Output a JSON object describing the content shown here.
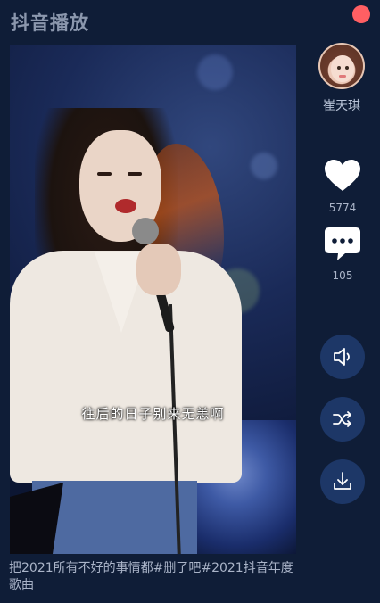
{
  "app": {
    "title": "抖音播放"
  },
  "video": {
    "subtitle": "往后的日子别来无恙啊"
  },
  "author": {
    "name": "崔天琪"
  },
  "actions": {
    "like_count": "5774",
    "comment_count": "105"
  },
  "icons": {
    "close": "close-dot-icon",
    "like": "heart-icon",
    "comment": "comment-bubble-icon",
    "sound": "speaker-icon",
    "shuffle": "shuffle-icon",
    "download": "download-icon"
  },
  "caption": {
    "text": "把2021所有不好的事情都#删了吧#2021抖音年度歌曲"
  },
  "colors": {
    "background": "#0f1d37",
    "button_bg": "#1d3767",
    "close_dot": "#ff5f63",
    "icon_white": "#ffffff"
  }
}
